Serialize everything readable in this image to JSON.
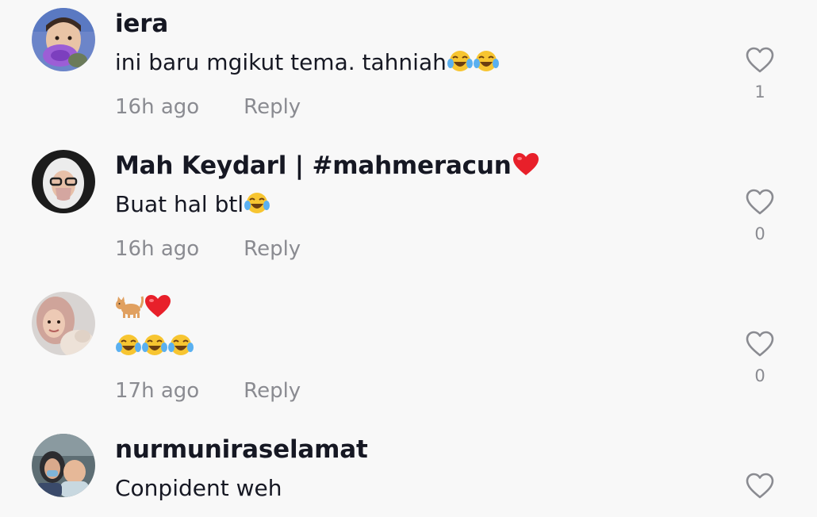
{
  "comments": [
    {
      "username": "iera",
      "text": "ini baru mgikut tema. tahniah",
      "text_emojis": [
        "face-with-tears-of-joy",
        "face-with-tears-of-joy"
      ],
      "time": "16h ago",
      "reply_label": "Reply",
      "likes": "1"
    },
    {
      "username": "Mah Keydarl | #mahmeracun",
      "username_emojis": [
        "red-heart"
      ],
      "text": "Buat hal btl",
      "text_emojis": [
        "face-with-tears-of-joy"
      ],
      "time": "16h ago",
      "reply_label": "Reply",
      "likes": "0"
    },
    {
      "username": "",
      "username_emojis": [
        "cat",
        "red-heart"
      ],
      "text": "",
      "text_emojis": [
        "face-with-tears-of-joy",
        "face-with-tears-of-joy",
        "face-with-tears-of-joy"
      ],
      "time": "17h ago",
      "reply_label": "Reply",
      "likes": "0"
    },
    {
      "username": "nurmuniraselamat",
      "text": "Conpident weh",
      "time": "",
      "reply_label": "",
      "likes": ""
    }
  ],
  "colors": {
    "background": "#f8f8f8",
    "primary_text": "#161823",
    "secondary_text": "#8a8b91"
  }
}
